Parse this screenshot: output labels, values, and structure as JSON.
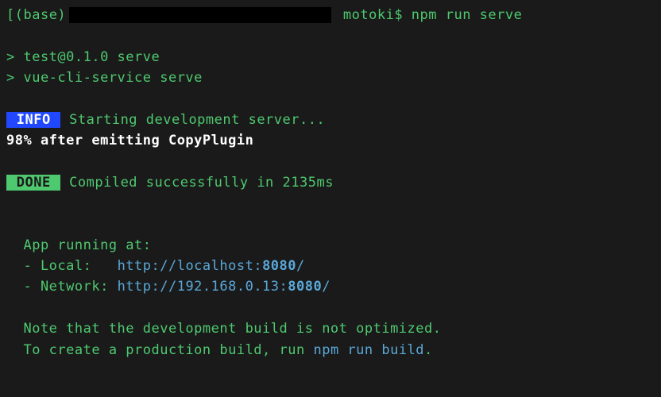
{
  "prompt": {
    "open_bracket": "[",
    "env": "(base)",
    "user": " motoki$ ",
    "command": "npm run serve"
  },
  "npm_header": {
    "line1": "> test@0.1.0 serve",
    "line2": "> vue-cli-service serve"
  },
  "info": {
    "badge": " INFO ",
    "text": " Starting development server..."
  },
  "progress": "98% after emitting CopyPlugin",
  "done": {
    "badge": " DONE ",
    "text": " Compiled successfully in 2135ms"
  },
  "app": {
    "heading": "  App running at:",
    "local_label": "  - Local:   ",
    "local_url_prefix": "http://localhost:",
    "local_port": "8080",
    "local_url_suffix": "/",
    "network_label": "  - Network: ",
    "network_url_prefix": "http://192.168.0.13:",
    "network_port": "8080",
    "network_url_suffix": "/",
    "note1": "  Note that the development build is not optimized.",
    "note2_prefix": "  To create a production build, run ",
    "note2_cmd": "npm run build",
    "note2_suffix": "."
  }
}
